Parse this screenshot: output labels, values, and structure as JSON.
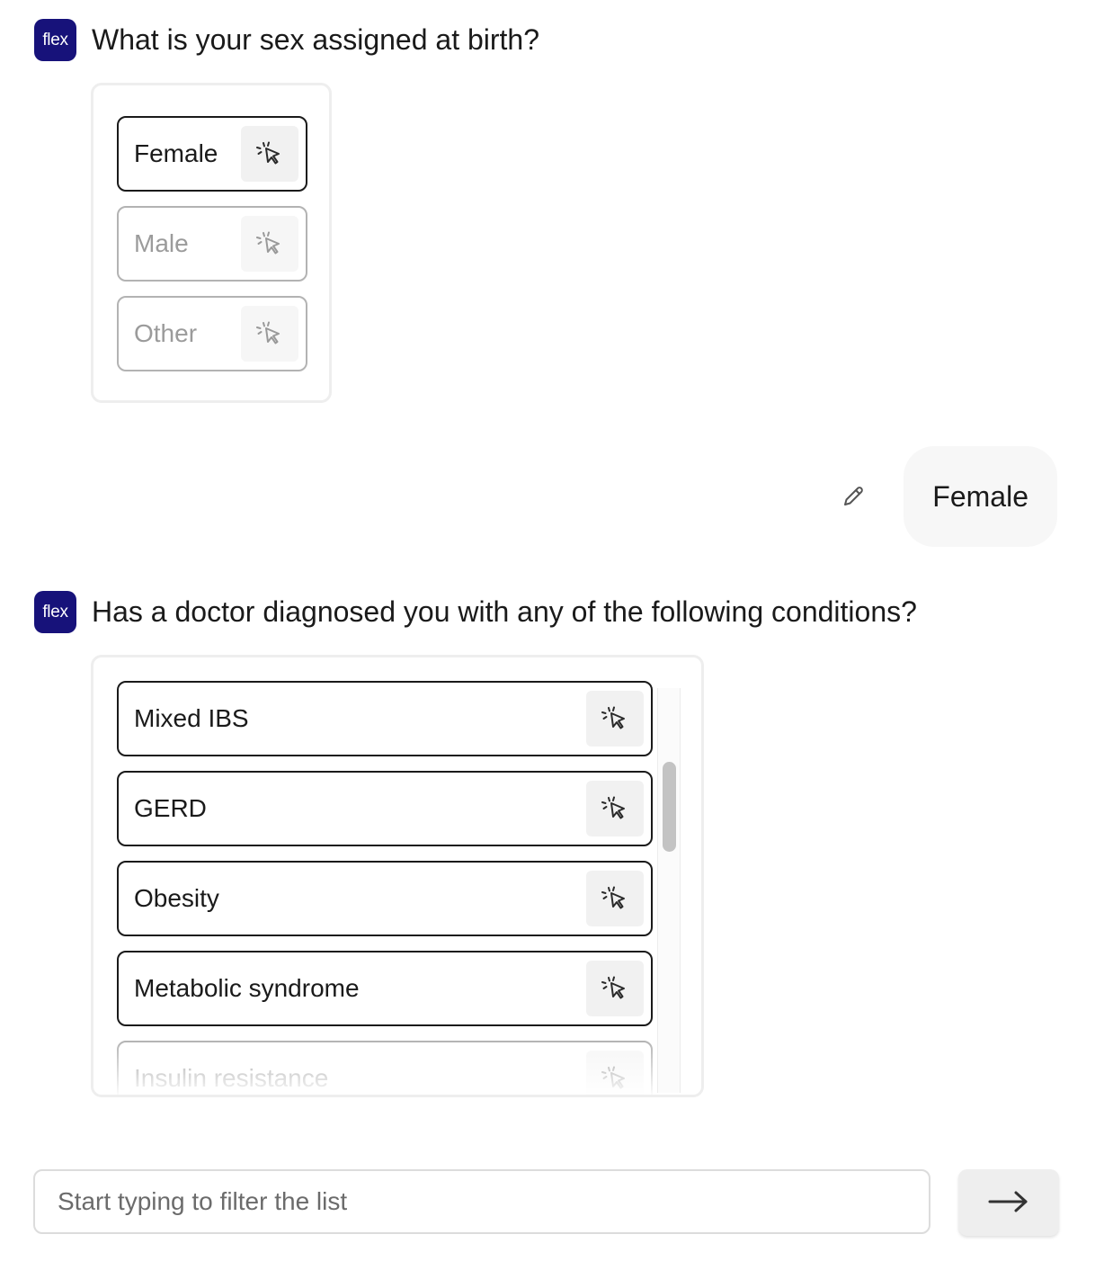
{
  "messages": {
    "q1": {
      "avatar_text": "flex",
      "question": "What is your sex assigned at birth?",
      "options": [
        {
          "label": "Female",
          "state": "selected"
        },
        {
          "label": "Male",
          "state": "faded"
        },
        {
          "label": "Other",
          "state": "faded"
        }
      ]
    },
    "answer1": {
      "text": "Female",
      "edit_icon": "pencil-icon"
    },
    "q2": {
      "avatar_text": "flex",
      "question": "Has a doctor diagnosed you with any of the following conditions?",
      "options": [
        {
          "label": "Mixed IBS"
        },
        {
          "label": "GERD"
        },
        {
          "label": "Obesity"
        },
        {
          "label": "Metabolic syndrome"
        },
        {
          "label": "Insulin resistance"
        }
      ]
    }
  },
  "composer": {
    "placeholder": "Start typing to filter the list",
    "send_icon": "arrow-right-icon"
  },
  "icons": {
    "option_select": "pointer-click-icon"
  },
  "colors": {
    "avatar_bg": "#17127a",
    "option_border": "#1a1a1a",
    "faded_border": "#b3b3b3",
    "bubble_bg": "#f7f7f7"
  }
}
